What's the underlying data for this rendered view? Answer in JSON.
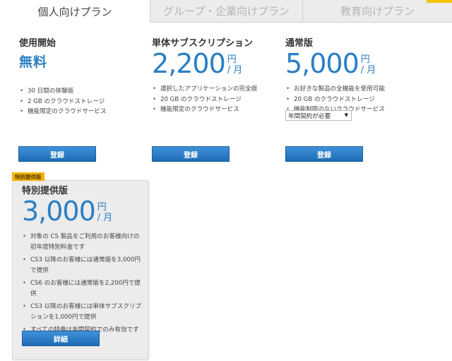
{
  "tabs": [
    {
      "label": "個人向けプラン"
    },
    {
      "label": "グループ・企業向けプラン"
    },
    {
      "label": "教育向けプラン"
    }
  ],
  "plans": {
    "trial": {
      "title": "使用開始",
      "price_text": "無料",
      "features": [
        "30 日間の体験版",
        "2 GB のクラウドストレージ",
        "機能限定のクラウドサービス"
      ],
      "button": "登録"
    },
    "single": {
      "title": "単体サブスクリプション",
      "price": "2,200",
      "yen": "円",
      "per": "/ 月",
      "features": [
        "選択したアプリケーションの完全版",
        "20 GB のクラウドストレージ",
        "機能限定のクラウドサービス"
      ],
      "button": "登録"
    },
    "regular": {
      "title": "通常版",
      "price": "5,000",
      "yen": "円",
      "per": "/ 月",
      "features": [
        "お好きな製品の全機能を使用可能",
        "20 GB のクラウドストレージ",
        "機能制限のないクラウドサービス"
      ],
      "select_value": "年間契約が必要",
      "button": "登録"
    }
  },
  "special": {
    "badge": "特別提供版",
    "title": "特別提供版",
    "price": "3,000",
    "yen": "円",
    "per": "/ 月",
    "features": [
      "対象の CS 製品をご利用のお客様向けの初年度特別料金です",
      "CS3 以降のお客様には通常版を3,000円で提供",
      "CS6 のお客様には通常版を2,200円で提供",
      "CS3 以降のお客様には単体サブスクリプションを1,000円で提供",
      "すべての特典は年間契約でのみ有効です"
    ],
    "button": "詳細"
  }
}
